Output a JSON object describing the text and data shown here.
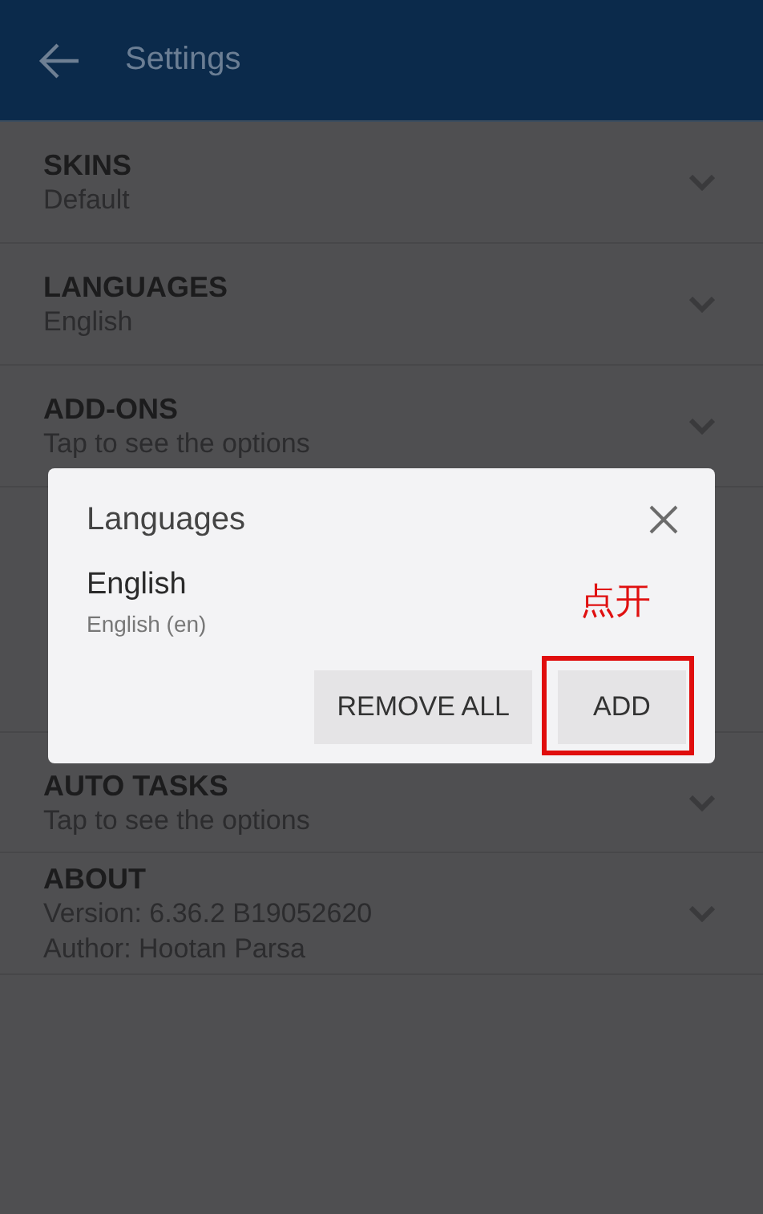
{
  "app_bar": {
    "title": "Settings"
  },
  "settings": [
    {
      "title": "SKINS",
      "lines": [
        "Default"
      ]
    },
    {
      "title": "LANGUAGES",
      "lines": [
        "English"
      ]
    },
    {
      "title": "ADD-ONS",
      "lines": [
        "Tap to see the options"
      ]
    },
    {
      "title": "AUTO TASKS",
      "lines": [
        "Tap to see the options"
      ]
    },
    {
      "title": "ABOUT",
      "lines": [
        "Version: 6.36.2  B19052620",
        "Author: Hootan Parsa"
      ]
    }
  ],
  "dialog": {
    "title": "Languages",
    "languages": [
      {
        "name": "English",
        "detail": "English (en)"
      }
    ],
    "buttons": [
      "REMOVE ALL",
      "ADD"
    ]
  },
  "annotation": {
    "text": "点开"
  }
}
